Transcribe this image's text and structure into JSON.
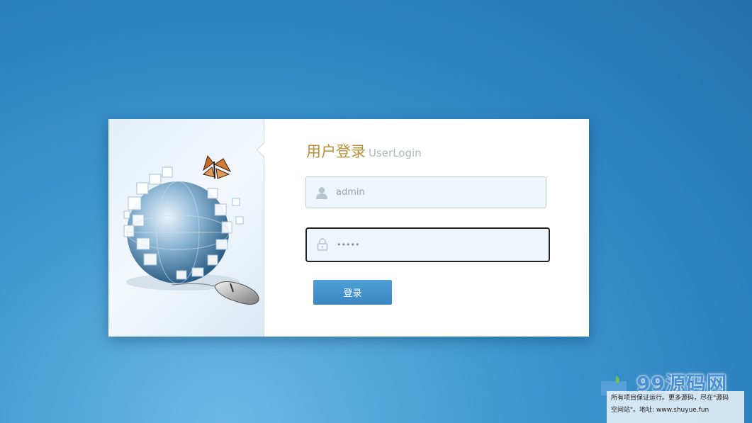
{
  "login": {
    "title_cn": "用户登录",
    "title_en": "UserLogin",
    "username_value": "admin",
    "password_value": "•••••",
    "submit_label": "登录"
  },
  "watermark": {
    "logo": "99源码网",
    "line1": "所有项目保证运行。更多源码，尽在\"源码",
    "line2": "空间站\"。地址: www.shuyue.fun"
  },
  "icons": {
    "user": "user-icon",
    "lock": "lock-icon"
  },
  "colors": {
    "title": "#b8913a",
    "button": "#3a86c2",
    "background": "#2a7fbd"
  }
}
